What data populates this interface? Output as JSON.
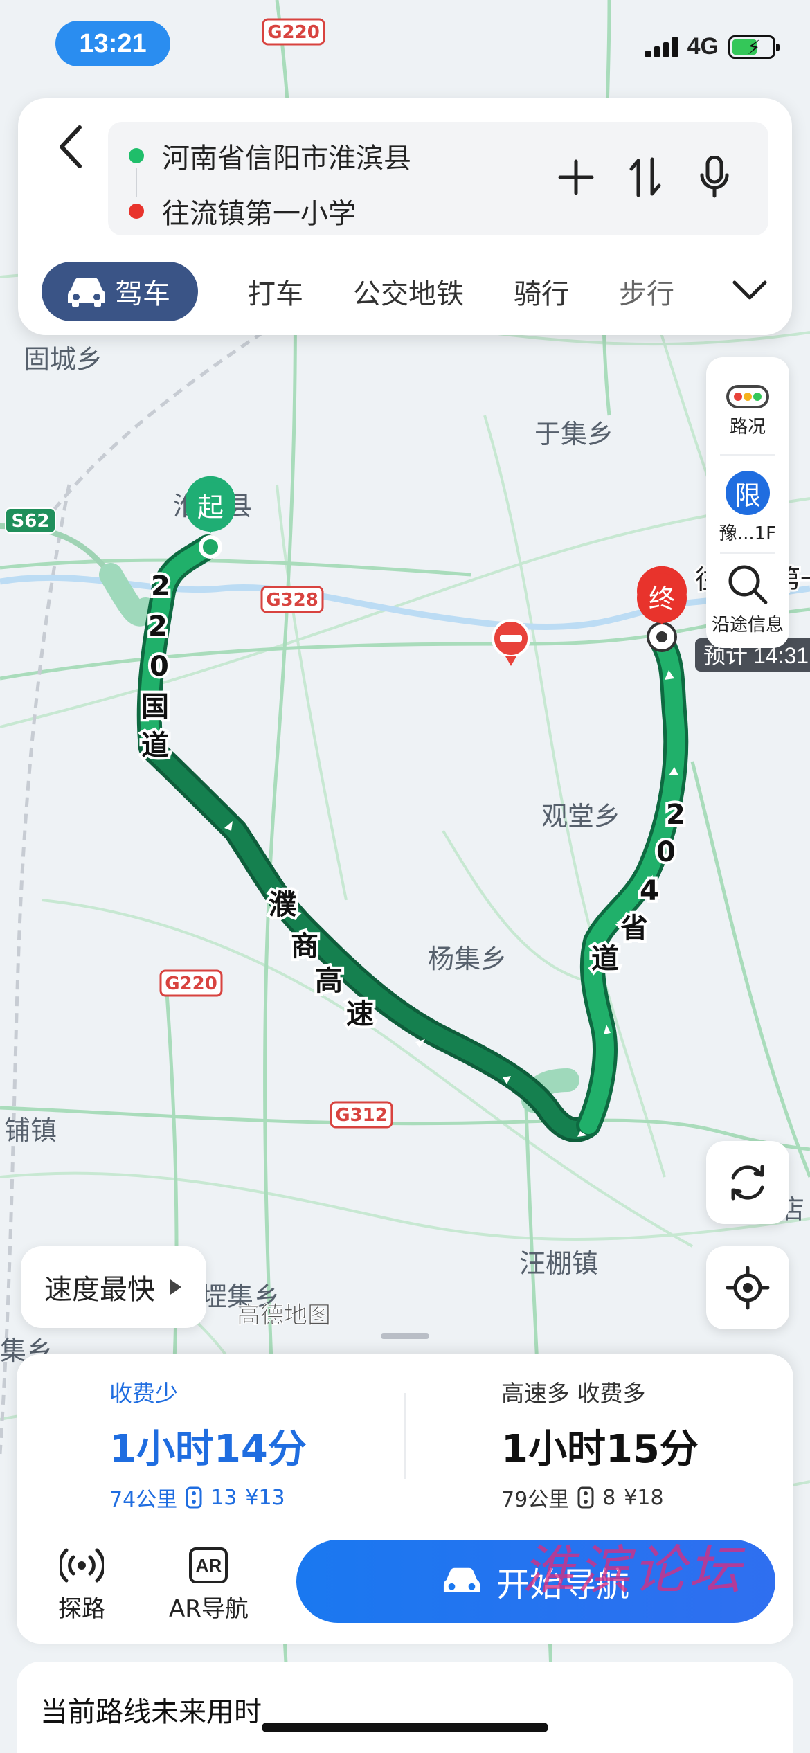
{
  "status": {
    "time": "13:21",
    "network": "4G"
  },
  "search": {
    "from": "河南省信阳市淮滨县",
    "to": "往流镇第一小学"
  },
  "modes": {
    "active": "驾车",
    "items": [
      "打车",
      "公交地铁",
      "骑行",
      "步行"
    ]
  },
  "map": {
    "places": [
      "固城乡",
      "于集乡",
      "淮滨县",
      "观堂乡",
      "杨集乡",
      "汪棚镇",
      "铺镇",
      "堽集乡",
      "往流镇第一小学",
      "集乡",
      "店"
    ],
    "shields": [
      "G220",
      "G328",
      "S62",
      "G220",
      "G312"
    ],
    "route_labels": {
      "west": "220国道",
      "south": "濮商高速",
      "east": "204省道"
    },
    "start_marker": "起",
    "end_marker": "终",
    "eta_prefix": "预计",
    "eta_time": "14:31",
    "provider": "高德地图"
  },
  "side_panel": {
    "traffic": "路况",
    "restriction_icon": "限",
    "restriction": "豫...1F",
    "along": "沿途信息"
  },
  "speed_filter": "速度最快",
  "routes": [
    {
      "tag": "收费少",
      "duration": "1小时14分",
      "distance": "74公里",
      "lights": "13",
      "toll": "¥13"
    },
    {
      "tag": "高速多  收费多",
      "duration": "1小时15分",
      "distance": "79公里",
      "lights": "8",
      "toll": "¥18"
    }
  ],
  "tools": {
    "explore": "探路",
    "ar": "AR导航",
    "ar_icon": "AR"
  },
  "start_button": "开始导航",
  "watermark": "淮滨论坛",
  "future": {
    "title": "当前路线未来用时"
  },
  "colors": {
    "route_green": "#1fa866",
    "route_dark": "#13734a",
    "accent_blue": "#1f6de0",
    "tab_active": "#3a5486"
  }
}
